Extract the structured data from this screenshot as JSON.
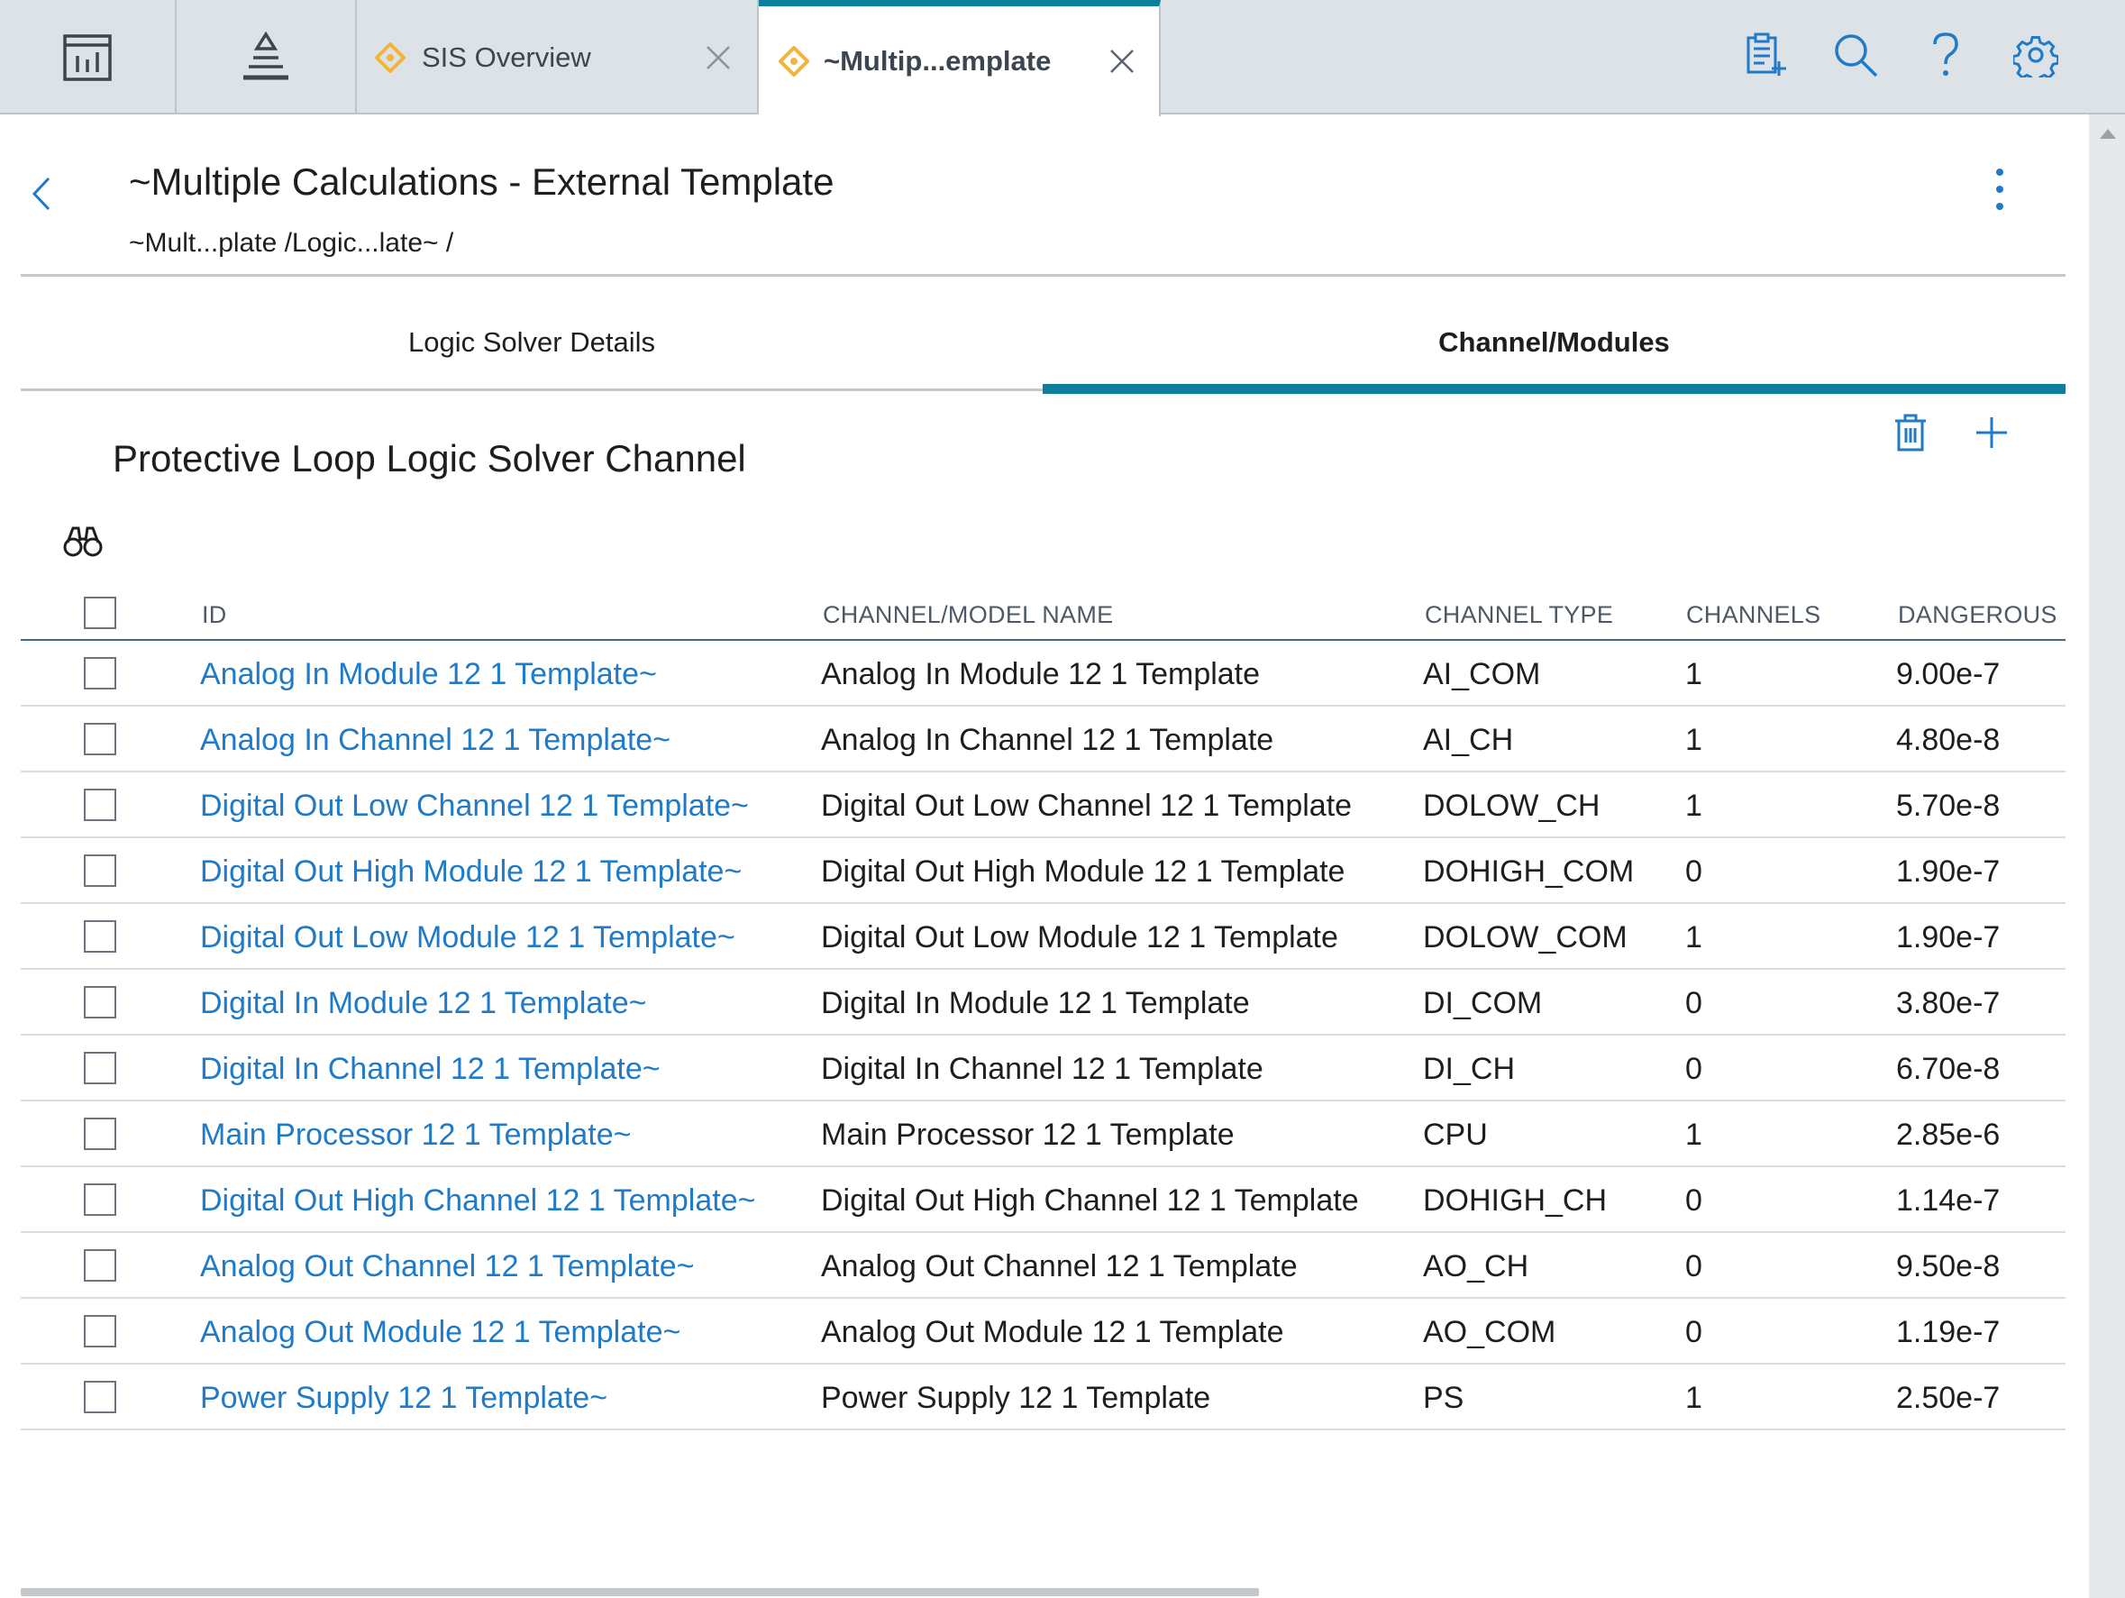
{
  "topbar": {
    "tabs": [
      {
        "label": "SIS Overview",
        "icon": "diamond-icon",
        "active": false
      },
      {
        "label": "~Multip...emplate",
        "icon": "diamond-icon",
        "active": true
      }
    ],
    "icons": [
      "dashboard-icon",
      "hierarchy-icon",
      "new-record-icon",
      "search-icon",
      "help-icon",
      "settings-icon"
    ]
  },
  "header": {
    "title": "~Multiple Calculations - External Template",
    "breadcrumb": "~Mult...plate /Logic...late~ /"
  },
  "section_tabs": [
    {
      "label": "Logic Solver Details",
      "active": false
    },
    {
      "label": "Channel/Modules",
      "active": true
    }
  ],
  "section": {
    "title": "Protective Loop Logic Solver Channel",
    "icons": [
      "delete-icon",
      "add-icon",
      "binoculars-icon"
    ]
  },
  "table": {
    "columns": [
      "ID",
      "CHANNEL/MODEL NAME",
      "CHANNEL TYPE",
      "CHANNELS",
      "DANGEROUS D"
    ],
    "rows": [
      {
        "id": "Analog In Module 12 1 Template~",
        "name": "Analog In Module 12 1 Template",
        "type": "AI_COM",
        "channels": "1",
        "dangerous": "9.00e-7"
      },
      {
        "id": "Analog In Channel 12 1 Template~",
        "name": "Analog In Channel 12 1 Template",
        "type": "AI_CH",
        "channels": "1",
        "dangerous": "4.80e-8"
      },
      {
        "id": "Digital Out Low Channel 12 1 Template~",
        "name": "Digital Out Low Channel 12 1 Template",
        "type": "DOLOW_CH",
        "channels": "1",
        "dangerous": "5.70e-8"
      },
      {
        "id": "Digital Out High Module 12 1 Template~",
        "name": "Digital Out High Module 12 1 Template",
        "type": "DOHIGH_COM",
        "channels": "0",
        "dangerous": "1.90e-7"
      },
      {
        "id": "Digital Out Low Module 12 1 Template~",
        "name": "Digital Out Low Module 12 1 Template",
        "type": "DOLOW_COM",
        "channels": "1",
        "dangerous": "1.90e-7"
      },
      {
        "id": "Digital In Module 12 1 Template~",
        "name": "Digital In Module 12 1 Template",
        "type": "DI_COM",
        "channels": "0",
        "dangerous": "3.80e-7"
      },
      {
        "id": "Digital In Channel 12 1 Template~",
        "name": "Digital In Channel 12 1 Template",
        "type": "DI_CH",
        "channels": "0",
        "dangerous": "6.70e-8"
      },
      {
        "id": "Main Processor 12 1 Template~",
        "name": "Main Processor 12 1 Template",
        "type": "CPU",
        "channels": "1",
        "dangerous": "2.85e-6"
      },
      {
        "id": "Digital Out High Channel 12 1 Template~",
        "name": "Digital Out High Channel 12 1 Template",
        "type": "DOHIGH_CH",
        "channels": "0",
        "dangerous": "1.14e-7"
      },
      {
        "id": "Analog Out Channel 12 1 Template~",
        "name": "Analog Out Channel 12 1 Template",
        "type": "AO_CH",
        "channels": "0",
        "dangerous": "9.50e-8"
      },
      {
        "id": "Analog Out Module 12 1 Template~",
        "name": "Analog Out Module 12 1 Template",
        "type": "AO_COM",
        "channels": "0",
        "dangerous": "1.19e-7"
      },
      {
        "id": "Power Supply 12 1 Template~",
        "name": "Power Supply 12 1 Template",
        "type": "PS",
        "channels": "1",
        "dangerous": "2.50e-7"
      }
    ]
  },
  "colors": {
    "accent": "#0d7f9a",
    "link": "#1f7ac7",
    "tab_icon": "#f2b43c",
    "topbar_bg": "#dde2e7"
  }
}
